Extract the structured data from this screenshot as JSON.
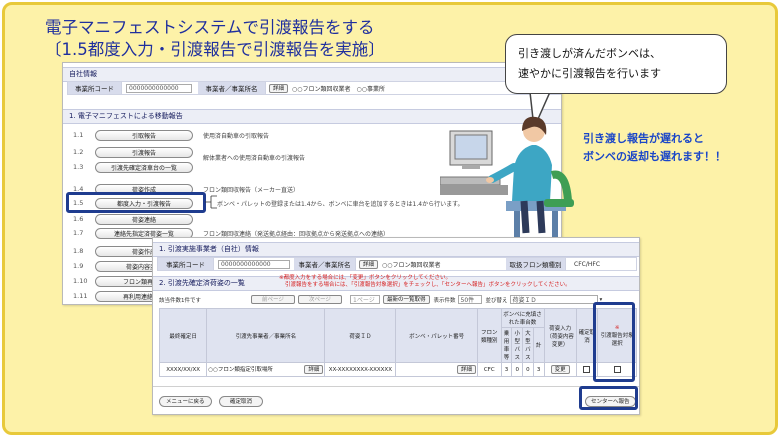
{
  "slide": {
    "title_line1": "電子マニフェストシステムで引渡報告をする",
    "title_line2": "〔1.5都度入力・引渡報告で引渡報告を実施〕"
  },
  "bubble": {
    "line1": "引き渡しが済んだボンベは、",
    "line2": "速やかに引渡報告を行います"
  },
  "callout": {
    "line1": "引き渡し報告が遅れると",
    "line2": "ボンベの返却も遅れます！！"
  },
  "back_panel": {
    "own_info_title": "自社情報",
    "office_code_label": "事業所コード",
    "office_code_value": "0000000000000",
    "company_label": "事業者／事業所名",
    "detail_label": "詳細",
    "company_value": "○○フロン類回収業者　○○事業所",
    "section_title": "1. 電子マニフェストによる移動報告",
    "menu": [
      {
        "num": "1.1",
        "label": "引取報告",
        "desc": "使用済自動車の引取報告"
      },
      {
        "num": "1.2",
        "label": "引渡報告",
        "desc": "解体業者への使用済自動車の引渡報告"
      },
      {
        "num": "1.3",
        "label": "引渡先確定済車台の一覧",
        "desc": ""
      },
      {
        "num": "1.4",
        "label": "荷姿作成",
        "desc": "フロン類回収報告（メーカー直送）"
      },
      {
        "num": "1.5",
        "label": "都度入力・引渡報告",
        "desc": "ボンベ・パレットの登録または1.4から、ボンベに車台を追加するときは1.4から行います。"
      },
      {
        "num": "1.6",
        "label": "荷姿連絡",
        "desc": ""
      },
      {
        "num": "1.7",
        "label": "連絡先指定済荷姿一覧",
        "desc": "フロン類回収連絡（発送拠点経由：回収拠点から発送拠点への連絡）"
      },
      {
        "num": "1.8",
        "label": "荷姿作成",
        "desc": ""
      },
      {
        "num": "1.9",
        "label": "荷姿内容変更",
        "desc": ""
      },
      {
        "num": "1.10",
        "label": "フロン類再利用",
        "desc": ""
      },
      {
        "num": "1.11",
        "label": "再利用連絡済荷",
        "desc": ""
      }
    ]
  },
  "front_panel": {
    "sec1_title": "1. 引渡実施事業者（自社）情報",
    "office_code_label": "事業所コード",
    "office_code_value": "0000000000000",
    "company_label": "事業者／事業所名",
    "detail_label": "詳細",
    "company_value": "○○フロン類回収業者",
    "category_label": "取扱フロン類種別",
    "category_value": "CFC/HFC",
    "sec2_title": "2. 引渡先確定済荷姿の一覧",
    "notice1": "※都度入力をする場合には、「変更」ボタンをクリックしてください。",
    "notice2": "引渡報告をする場合には、「引渡報告対象選択」をチェックし、「センターへ報告」ボタンをクリックしてください。",
    "result_count": "該当件数1件です",
    "prev_page": "前ページ",
    "next_page": "次ページ",
    "page_select": "1ページ",
    "latest_button": "最新の一覧取得",
    "display_count_label": "表示件数",
    "display_count_value": "50件",
    "sort_label": "並び替え",
    "sort_value": "荷姿ＩＤ",
    "columns": [
      "最終確定日",
      "引渡先事業者／事業所名",
      "荷姿ＩＤ",
      "ボンベ・パレット番号",
      "フロン類種別",
      "ボンベに充填された車台数",
      "荷姿入力（荷姿内容変更）",
      "確定取消",
      "引渡報告対象選択"
    ],
    "sub_columns": [
      "乗用車等",
      "小型バス",
      "大型バス",
      "計"
    ],
    "star_mark": "※",
    "row": {
      "date": "XXXX/XX/XX",
      "dest": "○○フロン類指定引取場所",
      "detail": "詳細",
      "package_id": "XX-XXXXXXXX-XXXXXX",
      "bombe_detail": "詳細",
      "type": "CFC",
      "counts": [
        "3",
        "0",
        "0",
        "3"
      ],
      "change": "変更"
    },
    "menu_back_button": "メニューに戻る",
    "confirm_cancel_button": "確定取消",
    "report_button": "センターへ報告"
  },
  "colors": {
    "title_blue": "#1f2f9e",
    "callout_blue": "#1a46c8",
    "highlight_navy": "#1f3c8f",
    "notice_red": "#d62020",
    "background_yellow": "#fdf2a8"
  }
}
